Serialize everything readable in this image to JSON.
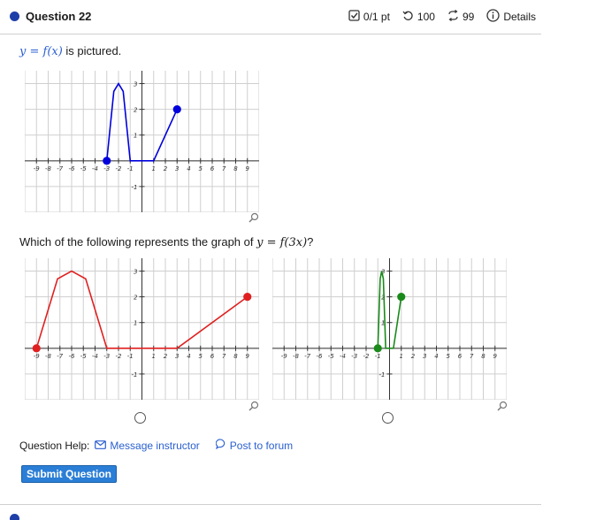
{
  "header": {
    "title": "Question 22",
    "score": "0/1 pt",
    "attempts": "100",
    "submissions": "99",
    "details_label": "Details"
  },
  "question": {
    "intro_math": "y = f(x)",
    "intro_text": "is pictured.",
    "prompt_text": "Which of the following represents the graph of",
    "prompt_math": "y = f(3x)",
    "prompt_end": "?"
  },
  "help": {
    "label": "Question Help:",
    "message_label": "Message instructor",
    "forum_label": "Post to forum"
  },
  "submit_label": "Submit Question",
  "icons": [
    "check-square-icon",
    "retry-icon",
    "refresh-icon",
    "info-icon",
    "magnifier-icon",
    "mail-icon",
    "comment-icon"
  ],
  "colors": {
    "accent": "#2a7ed6",
    "blue": "#0000dd",
    "red": "#e02020",
    "green": "#1a8a1a"
  },
  "chart_data": [
    {
      "type": "line",
      "xlim": [
        -10,
        10
      ],
      "ylim": [
        -2,
        3.5
      ],
      "x_ticks": [
        -9,
        -8,
        -7,
        -6,
        -5,
        -4,
        -3,
        -2,
        -1,
        1,
        2,
        3,
        4,
        5,
        6,
        7,
        8,
        9
      ],
      "y_ticks": [
        -1,
        1,
        2,
        3
      ],
      "grid": true,
      "series": [
        {
          "color": "#0000dd",
          "x": [
            -3,
            -2.4,
            -2,
            -1.6,
            -1,
            1,
            3
          ],
          "y": [
            0,
            2.7,
            3,
            2.7,
            0,
            0,
            2
          ]
        }
      ],
      "endpoints": [
        {
          "x": -3,
          "y": 0,
          "filled": true
        },
        {
          "x": 3,
          "y": 2,
          "filled": true
        }
      ]
    },
    {
      "type": "line",
      "xlim": [
        -10,
        10
      ],
      "ylim": [
        -2,
        3.5
      ],
      "x_ticks": [
        -9,
        -8,
        -7,
        -6,
        -5,
        -4,
        -3,
        -2,
        -1,
        1,
        2,
        3,
        4,
        5,
        6,
        7,
        8,
        9
      ],
      "y_ticks": [
        -1,
        1,
        2,
        3
      ],
      "grid": true,
      "series": [
        {
          "color": "#e02020",
          "x": [
            -9,
            -7.2,
            -6,
            -4.8,
            -3,
            3,
            9
          ],
          "y": [
            0,
            2.7,
            3,
            2.7,
            0,
            0,
            2
          ]
        }
      ],
      "endpoints": [
        {
          "x": -9,
          "y": 0,
          "filled": true
        },
        {
          "x": 9,
          "y": 2,
          "filled": true
        }
      ]
    },
    {
      "type": "line",
      "xlim": [
        -10,
        10
      ],
      "ylim": [
        -2,
        3.5
      ],
      "x_ticks": [
        -9,
        -8,
        -7,
        -6,
        -5,
        -4,
        -3,
        -2,
        -1,
        1,
        2,
        3,
        4,
        5,
        6,
        7,
        8,
        9
      ],
      "y_ticks": [
        -1,
        1,
        2,
        3
      ],
      "grid": true,
      "series": [
        {
          "color": "#1a8a1a",
          "x": [
            -1,
            -0.8,
            -0.67,
            -0.53,
            -0.33,
            0.33,
            1
          ],
          "y": [
            0,
            2.7,
            3,
            2.7,
            0,
            0,
            2
          ]
        }
      ],
      "endpoints": [
        {
          "x": -1,
          "y": 0,
          "filled": true
        },
        {
          "x": 1,
          "y": 2,
          "filled": true
        }
      ]
    }
  ]
}
